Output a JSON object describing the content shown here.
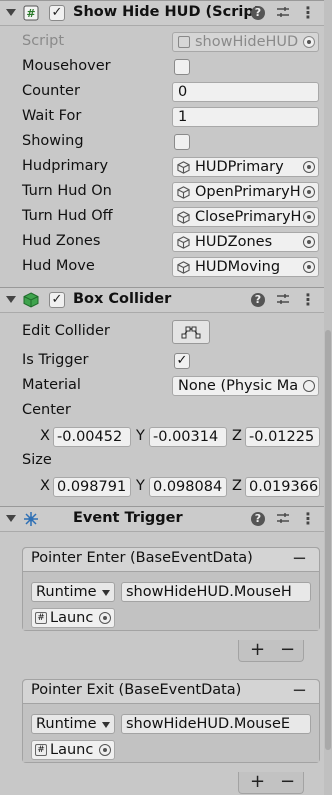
{
  "show_hide_hud": {
    "title": "Show Hide HUD (Script",
    "enabled": "✓",
    "script_label": "Script",
    "script_value": "showHideHUD",
    "fields": {
      "mousehover": "Mousehover",
      "counter": "Counter",
      "counter_value": "0",
      "wait_for": "Wait For",
      "wait_for_value": "1",
      "showing": "Showing",
      "hudprimary": "Hudprimary",
      "hudprimary_value": "HUDPrimary",
      "turn_hud_on": "Turn Hud On",
      "turn_hud_on_value": "OpenPrimaryH",
      "turn_hud_off": "Turn Hud Off",
      "turn_hud_off_value": "ClosePrimaryH",
      "hud_zones": "Hud Zones",
      "hud_zones_value": "HUDZones",
      "hud_move": "Hud Move",
      "hud_move_value": "HUDMoving"
    }
  },
  "box_collider": {
    "title": "Box Collider",
    "enabled": "✓",
    "edit_collider": "Edit Collider",
    "is_trigger": "Is Trigger",
    "is_trigger_check": "✓",
    "material": "Material",
    "material_value": "None (Physic Ma",
    "center": "Center",
    "center_x": "-0.00452",
    "center_y": "-0.00314",
    "center_z": "-0.01225",
    "size": "Size",
    "size_x": "0.098791",
    "size_y": "0.098084",
    "size_z": "0.019366",
    "x": "X",
    "y": "Y",
    "z": "Z"
  },
  "event_trigger": {
    "title": "Event Trigger",
    "entries": [
      {
        "title": "Pointer Enter (BaseEventData)",
        "mode": "Runtime",
        "function": "showHideHUD.MouseH",
        "target": "Launc"
      },
      {
        "title": "Pointer Exit (BaseEventData)",
        "mode": "Runtime",
        "function": "showHideHUD.MouseE",
        "target": "Launc"
      }
    ],
    "plus": "+",
    "minus": "−"
  },
  "icons": {
    "script": "hash-script-icon",
    "collider": "green-cube-icon",
    "event": "event-trigger-icon",
    "help": "help-icon",
    "presets": "presets-icon",
    "menu": "kebab-menu-icon"
  },
  "colors": {
    "panel": "#c8c8c8",
    "field": "#f0f0f0",
    "header": "#cbcbcb"
  }
}
